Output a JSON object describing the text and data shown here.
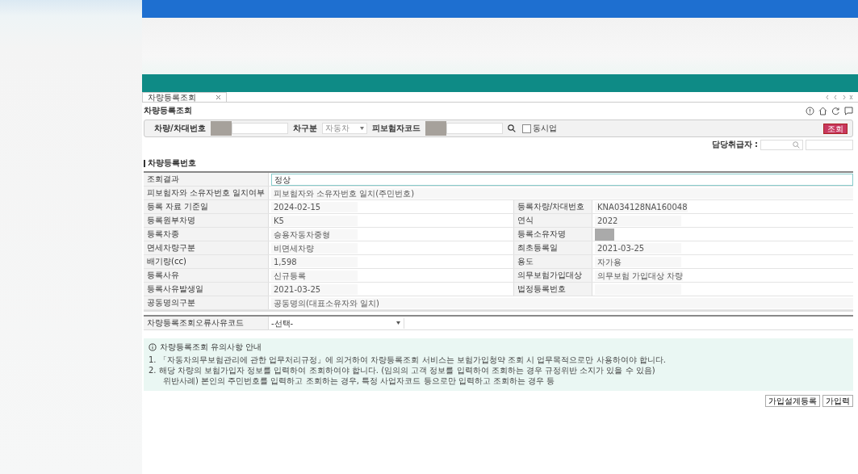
{
  "tab": {
    "label": "차량등록조회"
  },
  "page_title": "차량등록조회",
  "search": {
    "fields": [
      {
        "kind": "text",
        "label": "차량/차대번호",
        "redacted": true
      },
      {
        "kind": "select",
        "label": "차구분",
        "value": "자동차"
      },
      {
        "kind": "text",
        "label": "피보험자코드",
        "redacted": true
      }
    ],
    "checkbox": {
      "label": "동시업",
      "checked": false
    },
    "button": "조회"
  },
  "handler": {
    "label": "담당취급자 :"
  },
  "section_title": "차량등록번호",
  "rows": [
    {
      "kind": "result",
      "label": "조회결과",
      "value": "정상"
    },
    {
      "kind": "full",
      "label": "피보험자와 소유자번호 일치여부",
      "value": "피보험자와 소유자번호 일치(주민번호)"
    },
    {
      "kind": "pair",
      "cells": [
        {
          "label": "등록 자료 기준일",
          "value": "2024-02-15"
        },
        {
          "label": "등록차량/차대번호",
          "value": "KNA034128NA160048"
        }
      ]
    },
    {
      "kind": "pair",
      "cells": [
        {
          "label": "등록원부차명",
          "value": "K5"
        },
        {
          "label": "연식",
          "value": "2022"
        }
      ]
    },
    {
      "kind": "pair",
      "cells": [
        {
          "label": "등록차종",
          "value": "승용자동차중형"
        },
        {
          "label": "등록소유자명",
          "redacted": true
        }
      ]
    },
    {
      "kind": "pair",
      "cells": [
        {
          "label": "면세차량구분",
          "value": "비면세차량"
        },
        {
          "label": "최초등록일",
          "value": "2021-03-25"
        }
      ]
    },
    {
      "kind": "pair",
      "cells": [
        {
          "label": "배기량(cc)",
          "value": "1,598"
        },
        {
          "label": "용도",
          "value": "자가용"
        }
      ]
    },
    {
      "kind": "pair",
      "cells": [
        {
          "label": "등록사유",
          "value": "신규등록"
        },
        {
          "label": "의무보험가입대상",
          "value": "의무보험 가입대상 차량"
        }
      ]
    },
    {
      "kind": "pair",
      "cells": [
        {
          "label": "등록사유발생일",
          "value": "2021-03-25"
        },
        {
          "label": "법정등록번호"
        }
      ]
    },
    {
      "kind": "full",
      "label": "공동명의구분",
      "value": "공동명의(대표소유자와 일치)"
    }
  ],
  "error_code": {
    "label": "차량등록조회오류사유코드",
    "value": "-선택-"
  },
  "notice": {
    "title": "차량등록조회 유의사항 안내",
    "lines": [
      "1. 「자동차의무보험관리에 관한 업무처리규정」에 의거하여 차량등록조회 서비스는 보험가입청약 조회 시 업무목적으로만 사용하여야 합니다.",
      "2. 해당 차량의 보험가입자 정보를 입력하여 조회하여야 합니다. (임의의 고객 정보를 입력하여 조회하는 경우 규정위반 소지가 있을 수 있음)",
      "위반사례) 본인의 주민번호를 입력하고 조회하는 경우, 특정 사업자코드 등으로만 입력하고 조회하는 경우 등"
    ]
  },
  "buttons": [
    "가입설계등록",
    "가입력"
  ]
}
